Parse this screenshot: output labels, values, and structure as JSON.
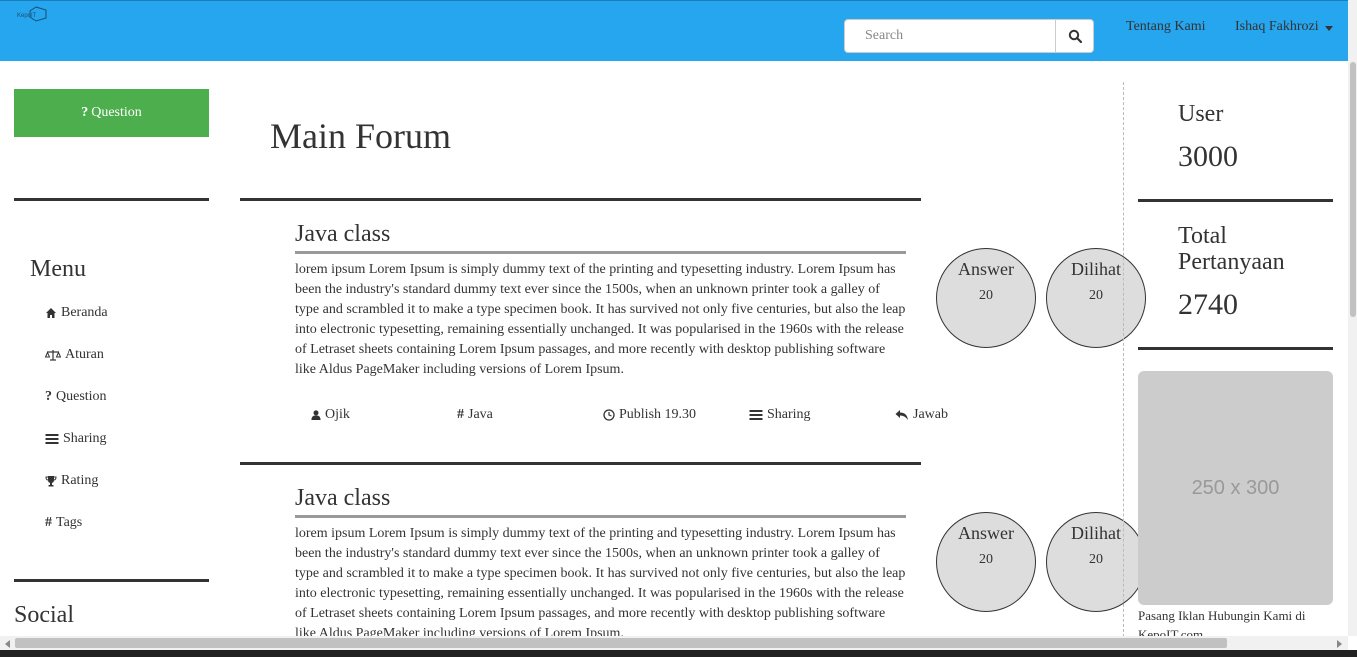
{
  "navbar": {
    "logo_alt": "KepoIT",
    "search_placeholder": "Search",
    "tentang_label": "Tentang Kami",
    "user_label": "Ishaq Fakhrozi",
    "search_icon": "search-icon"
  },
  "sidebar": {
    "question_button": "Question",
    "menu_title": "Menu",
    "items": [
      {
        "label": "Beranda",
        "icon": "home-icon"
      },
      {
        "label": "Aturan",
        "icon": "balance-scale-icon"
      },
      {
        "label": "Question",
        "icon": "question-icon"
      },
      {
        "label": "Sharing",
        "icon": "list-icon"
      },
      {
        "label": "Rating",
        "icon": "trophy-icon"
      },
      {
        "label": "Tags",
        "icon": "hashtag-icon"
      }
    ],
    "social_title": "Social"
  },
  "main": {
    "title": "Main Forum",
    "posts": [
      {
        "title": "Java class",
        "body": "lorem ipsum Lorem Ipsum is simply dummy text of the printing and typesetting industry. Lorem Ipsum has been the industry's standard dummy text ever since the 1500s, when an unknown printer took a galley of type and scrambled it to make a type specimen book. It has survived not only five centuries, but also the leap into electronic typesetting, remaining essentially unchanged. It was popularised in the 1960s with the release of Letraset sheets containing Lorem Ipsum passages, and more recently with desktop publishing software like Aldus PageMaker including versions of Lorem Ipsum.",
        "author": "Ojik",
        "tag": "Java",
        "publish": "Publish 19.30",
        "category": "Sharing",
        "reply": "Jawab",
        "answer_label": "Answer",
        "answer_count": "20",
        "view_label": "Dilihat",
        "view_count": "20"
      },
      {
        "title": "Java class",
        "body": "lorem ipsum Lorem Ipsum is simply dummy text of the printing and typesetting industry. Lorem Ipsum has been the industry's standard dummy text ever since the 1500s, when an unknown printer took a galley of type and scrambled it to make a type specimen book. It has survived not only five centuries, but also the leap into electronic typesetting, remaining essentially unchanged. It was popularised in the 1960s with the release of Letraset sheets containing Lorem Ipsum passages, and more recently with desktop publishing software like Aldus PageMaker including versions of Lorem Ipsum.",
        "answer_label": "Answer",
        "answer_count": "20",
        "view_label": "Dilihat",
        "view_count": "20"
      }
    ]
  },
  "right": {
    "user_label": "User",
    "user_value": "3000",
    "total_label": "Total Pertanyaan",
    "total_value": "2740",
    "ad_placeholder": "250 x 300",
    "ad_text": "Pasang Iklan Hubungin Kami di KepoIT.com"
  },
  "colors": {
    "navbar": "#25a6ee",
    "question_button": "#4cae4c",
    "circle_fill": "#dddddd",
    "ad_box": "#cccccc"
  }
}
